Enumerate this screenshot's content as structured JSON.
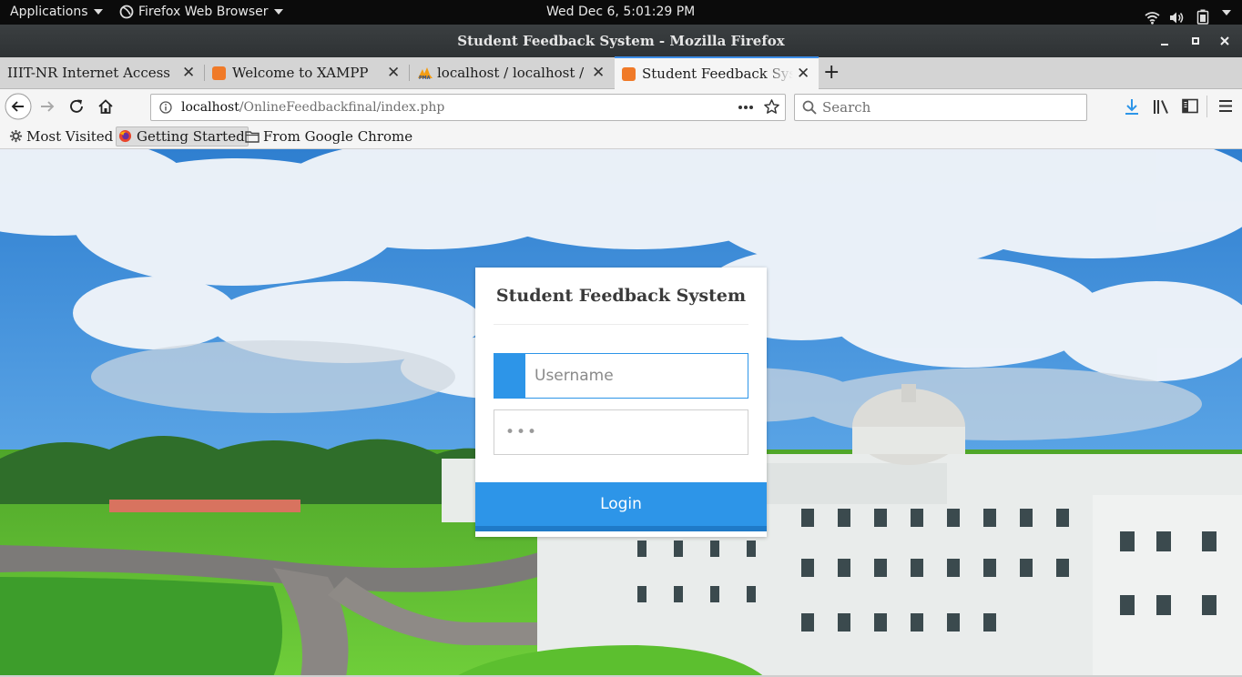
{
  "system_bar": {
    "applications_label": "Applications",
    "active_app_label": "Firefox Web Browser",
    "clock": "Wed Dec  6,  5:01:29 PM",
    "icons": [
      "wifi-icon",
      "volume-icon",
      "battery-icon"
    ]
  },
  "window": {
    "title": "Student Feedback System - Mozilla Firefox",
    "controls": [
      "minimize-icon",
      "maximize-icon",
      "close-icon"
    ]
  },
  "tabs": [
    {
      "label": "IIIT-NR Internet Access",
      "icon": "none",
      "active": false
    },
    {
      "label": "Welcome to XAMPP",
      "icon": "xampp-icon",
      "active": false
    },
    {
      "label": "localhost / localhost / sfs",
      "icon": "phpmyadmin-icon",
      "active": false
    },
    {
      "label": "Student Feedback System",
      "icon": "xampp-icon",
      "active": true
    }
  ],
  "navbar": {
    "url_host": "localhost",
    "url_path": "/OnlineFeedbackfinal/index.php",
    "search_placeholder": "Search"
  },
  "bookmarks": [
    {
      "label": "Most Visited",
      "icon": "gear-icon"
    },
    {
      "label": "Getting Started",
      "icon": "firefox-icon"
    },
    {
      "label": "From Google Chrome",
      "icon": "folder-icon"
    }
  ],
  "login": {
    "title": "Student Feedback System",
    "username_placeholder": "Username",
    "password_value": "•••",
    "button_label": "Login"
  },
  "colors": {
    "accent": "#2d95e8",
    "tab_active_border": "#3d8ee8",
    "download_icon": "#2d95e8"
  }
}
